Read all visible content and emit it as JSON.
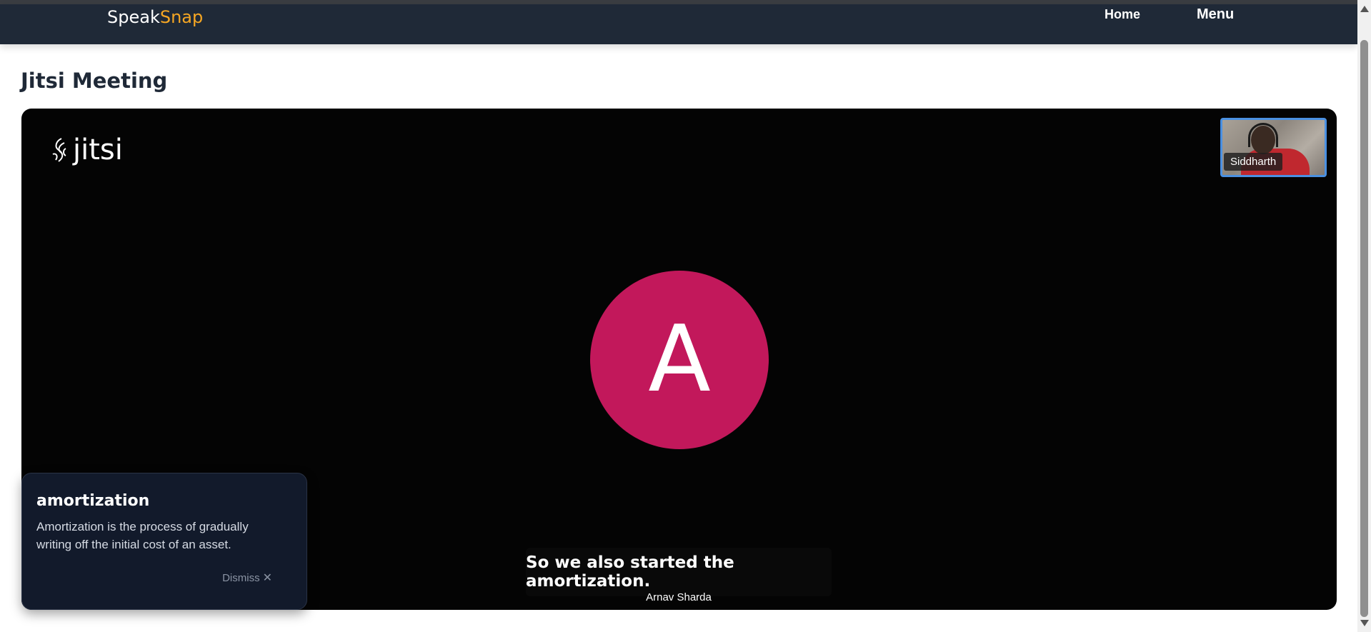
{
  "nav": {
    "brand_part1": "Speak",
    "brand_part2": "Snap",
    "home": "Home",
    "menu": "Menu"
  },
  "page": {
    "title": "Jitsi Meeting"
  },
  "meeting": {
    "logo_text": "jitsi",
    "thumbnail_name": "Siddharth",
    "avatar_initial": "A",
    "caption": "So we also started the amortization.",
    "speaker": "Arnav Sharda"
  },
  "definition": {
    "term": "amortization",
    "text": "Amortization is the process of gradually writing off the initial cost of an asset.",
    "dismiss": "Dismiss",
    "dismiss_icon": "close-icon"
  },
  "colors": {
    "navbar": "#1f2937",
    "brand_accent": "#f5a623",
    "avatar": "#c2185b",
    "card": "#121a2b",
    "thumb_border": "#4a90e2"
  }
}
